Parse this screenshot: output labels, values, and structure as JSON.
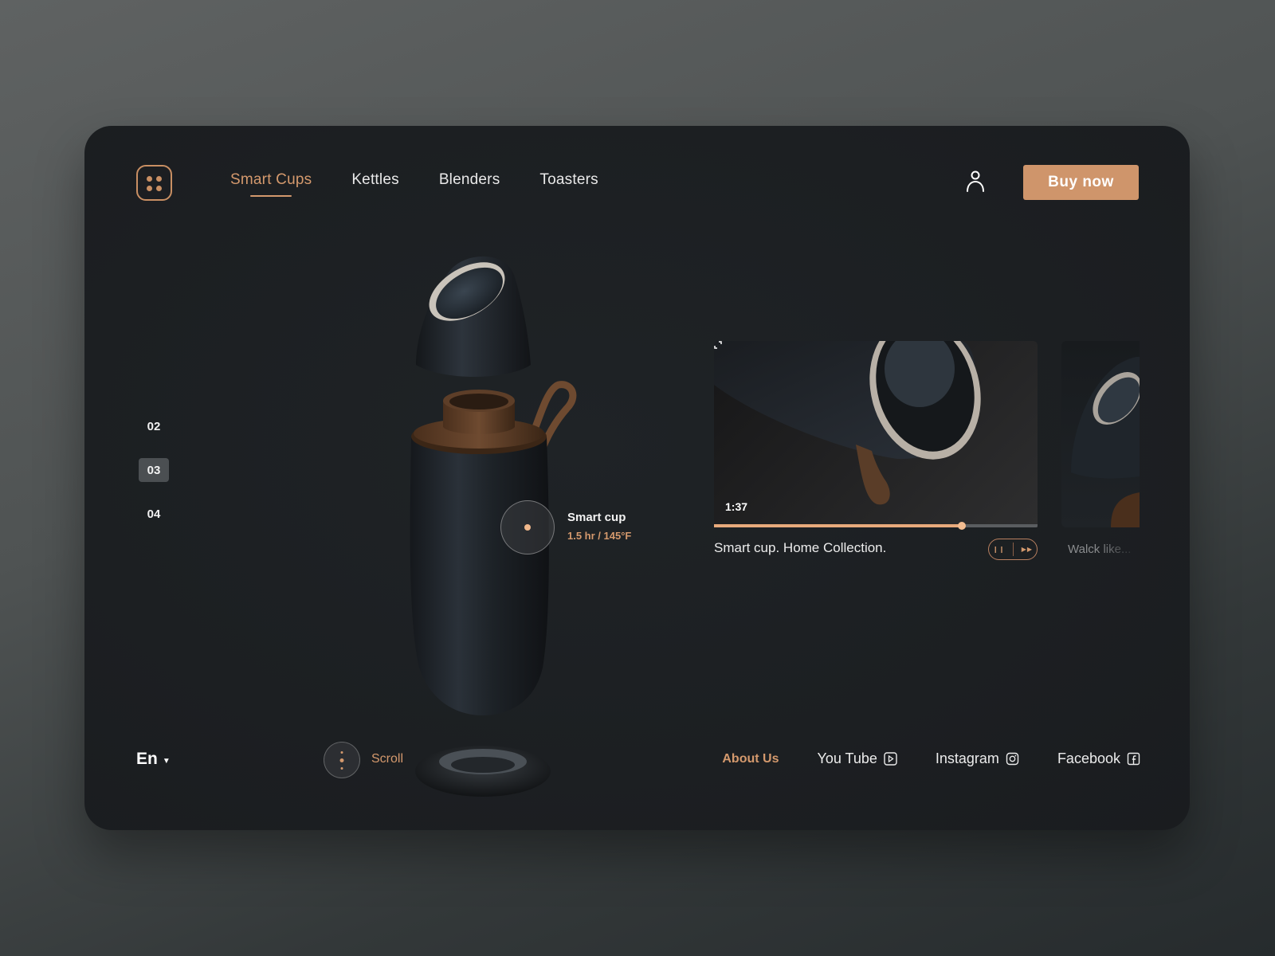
{
  "header": {
    "logo_icon": "four-dots-icon",
    "nav": [
      {
        "label": "Smart Cups",
        "active": true
      },
      {
        "label": "Kettles",
        "active": false
      },
      {
        "label": "Blenders",
        "active": false
      },
      {
        "label": "Toasters",
        "active": false
      }
    ],
    "user_icon": "user-icon",
    "buy_label": "Buy now"
  },
  "pager": {
    "items": [
      "02",
      "03",
      "04"
    ],
    "active": "03"
  },
  "product": {
    "callout_title": "Smart cup",
    "callout_sub": "1.5 hr / 145°F"
  },
  "videos": [
    {
      "time": "1:37",
      "progress": 0.765,
      "caption": "Smart cup. Home Collection.",
      "controls": {
        "pause_icon": "pause-icon",
        "next_icon": "fast-forward-icon"
      },
      "expand_icon": "expand-icon"
    },
    {
      "caption": "Walck like..."
    }
  ],
  "footer": {
    "language": "En",
    "scroll_label": "Scroll",
    "links": [
      {
        "label": "About Us",
        "icon": null,
        "active": true
      },
      {
        "label": "You Tube",
        "icon": "youtube-icon",
        "active": false
      },
      {
        "label": "Instagram",
        "icon": "instagram-icon",
        "active": false
      },
      {
        "label": "Facebook",
        "icon": "facebook-icon",
        "active": false
      }
    ]
  },
  "colors": {
    "accent": "#cf956b",
    "background": "#1c1f22",
    "text": "#ececec"
  }
}
